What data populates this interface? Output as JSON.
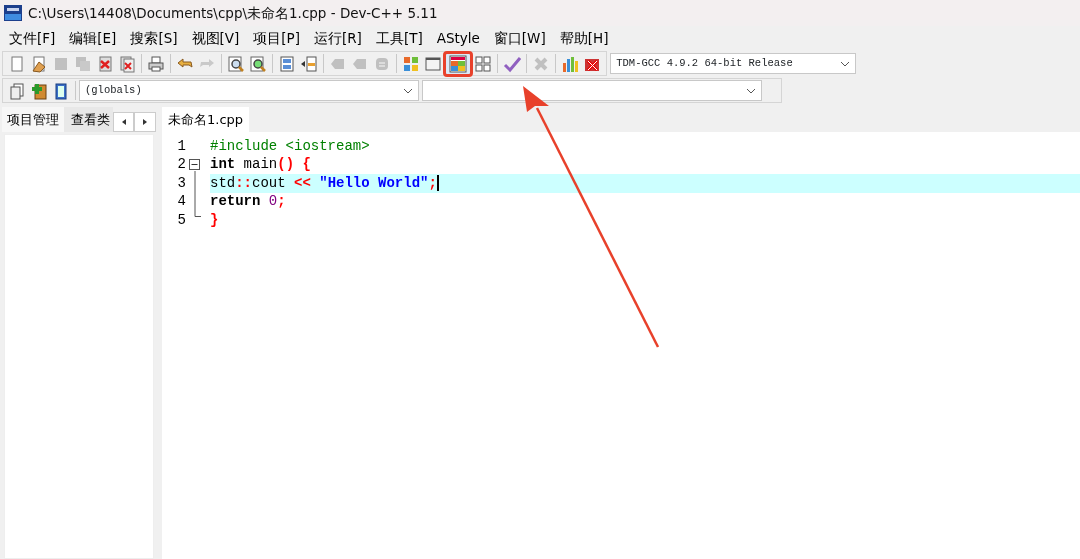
{
  "window": {
    "title": "C:\\Users\\14408\\Documents\\cpp\\未命名1.cpp - Dev-C++ 5.11"
  },
  "menu": [
    "文件[F]",
    "编辑[E]",
    "搜索[S]",
    "视图[V]",
    "项目[P]",
    "运行[R]",
    "工具[T]",
    "AStyle",
    "窗口[W]",
    "帮助[H]"
  ],
  "toolbar": [
    [
      {
        "kind": "new",
        "disabled": false,
        "highlighted": false
      },
      {
        "kind": "open",
        "disabled": false,
        "highlighted": false
      },
      {
        "kind": "save",
        "disabled": true,
        "highlighted": false
      },
      {
        "kind": "saveall",
        "disabled": true,
        "highlighted": false
      },
      {
        "kind": "close",
        "disabled": false,
        "highlighted": false
      },
      {
        "kind": "closeall",
        "disabled": false,
        "highlighted": false
      }
    ],
    [
      {
        "kind": "print",
        "disabled": false,
        "highlighted": false
      }
    ],
    [
      {
        "kind": "undo",
        "disabled": false,
        "highlighted": false
      },
      {
        "kind": "redo",
        "disabled": true,
        "highlighted": false
      }
    ],
    [
      {
        "kind": "find",
        "disabled": false,
        "highlighted": false
      },
      {
        "kind": "replace",
        "disabled": false,
        "highlighted": false
      }
    ],
    [
      {
        "kind": "indent",
        "disabled": false,
        "highlighted": false
      },
      {
        "kind": "unindent",
        "disabled": false,
        "highlighted": false
      }
    ],
    [
      {
        "kind": "bookmark",
        "disabled": true,
        "highlighted": false
      },
      {
        "kind": "bookmark",
        "disabled": true,
        "highlighted": false
      },
      {
        "kind": "goto",
        "disabled": true,
        "highlighted": false
      }
    ],
    [
      {
        "kind": "grid",
        "disabled": false,
        "highlighted": false
      },
      {
        "kind": "window",
        "disabled": false,
        "highlighted": false
      },
      {
        "kind": "tiles",
        "disabled": false,
        "highlighted": true
      },
      {
        "kind": "outline",
        "disabled": false,
        "highlighted": false
      }
    ],
    [
      {
        "kind": "check",
        "disabled": false,
        "highlighted": false
      }
    ],
    [
      {
        "kind": "cross",
        "disabled": true,
        "highlighted": false
      }
    ],
    [
      {
        "kind": "chart",
        "disabled": false,
        "highlighted": false
      },
      {
        "kind": "stop",
        "disabled": false,
        "highlighted": false
      }
    ]
  ],
  "compiler": {
    "value": "TDM-GCC 4.9.2 64-bit Release"
  },
  "toolbar2": [
    {
      "kind": "project"
    },
    {
      "kind": "add"
    },
    {
      "kind": "classbrowser"
    }
  ],
  "scope_combo": {
    "value": "(globals)"
  },
  "panel_tabs": [
    {
      "label": "项目管理",
      "selected": true
    },
    {
      "label": "查看类",
      "selected": false
    }
  ],
  "editor_tabs": [
    {
      "label": "未命名1.cpp",
      "selected": true
    }
  ],
  "code": [
    {
      "number": "1",
      "current": false,
      "tokens": [
        {
          "kind": "pre",
          "text": "#include <iostream>"
        }
      ]
    },
    {
      "number": "2",
      "current": false,
      "fold_expanded": true,
      "tokens": [
        {
          "kind": "kw",
          "text": "int"
        },
        {
          "kind": "plain",
          "text": " main"
        },
        {
          "kind": "sym",
          "text": "()"
        },
        {
          "kind": "sym",
          "text": " {"
        }
      ]
    },
    {
      "number": "3",
      "current": true,
      "tokens": [
        {
          "kind": "plain",
          "text": "std"
        },
        {
          "kind": "sym",
          "text": "::"
        },
        {
          "kind": "plain",
          "text": "cout "
        },
        {
          "kind": "sym",
          "text": "<<"
        },
        {
          "kind": "str",
          "text": " \"Hello World\""
        },
        {
          "kind": "sym",
          "text": ";"
        }
      ]
    },
    {
      "number": "4",
      "current": false,
      "tokens": [
        {
          "kind": "kw",
          "text": "return "
        },
        {
          "kind": "num",
          "text": "0"
        },
        {
          "kind": "sym",
          "text": ";"
        }
      ]
    },
    {
      "number": "5",
      "current": false,
      "tokens": [
        {
          "kind": "sym",
          "text": "}"
        }
      ]
    }
  ]
}
